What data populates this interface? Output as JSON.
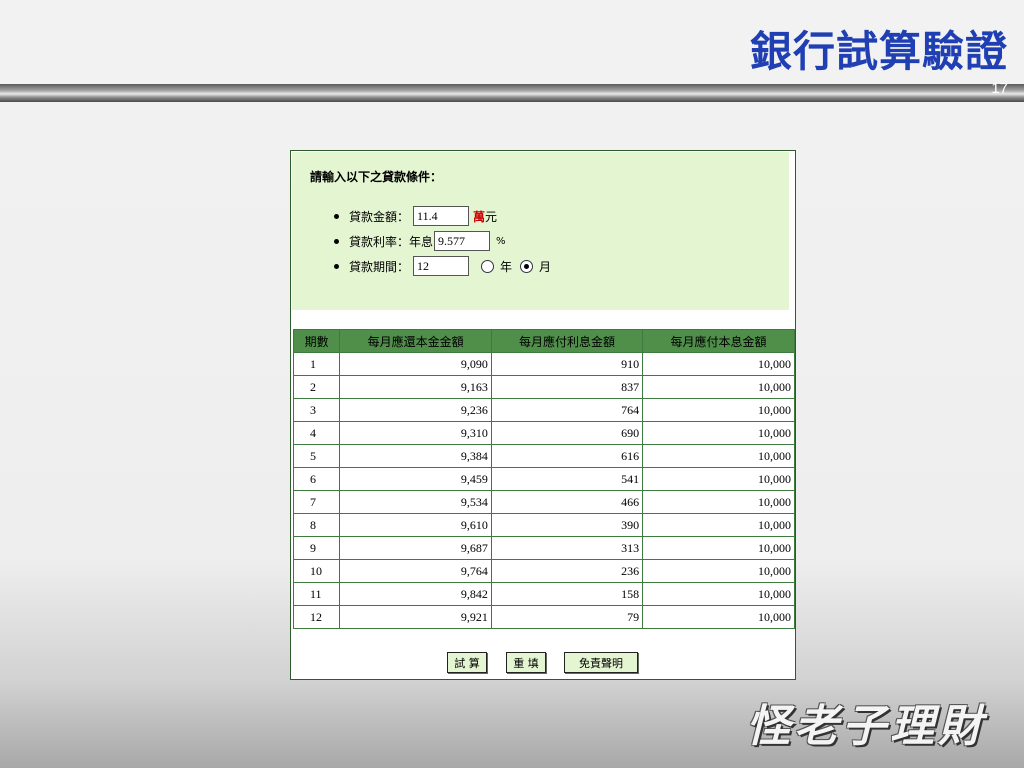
{
  "slide": {
    "title": "銀行試算驗證",
    "page_number": "17",
    "logo_text": "怪老子理財"
  },
  "form": {
    "title": "請輸入以下之貸款條件：",
    "amount_label": "貸款金額：",
    "amount_value": "11.4",
    "amount_unit_red": "萬",
    "amount_unit": "元",
    "rate_label": "貸款利率：年息",
    "rate_value": "9.577",
    "rate_unit": "%",
    "period_label": "貸款期間：",
    "period_value": "12",
    "period_options": [
      {
        "label": "年",
        "selected": false
      },
      {
        "label": "月",
        "selected": true
      }
    ]
  },
  "table": {
    "headers": [
      "期數",
      "每月應還本金金額",
      "每月應付利息金額",
      "每月應付本息金額"
    ],
    "rows": [
      [
        "1",
        "9,090",
        "910",
        "10,000"
      ],
      [
        "2",
        "9,163",
        "837",
        "10,000"
      ],
      [
        "3",
        "9,236",
        "764",
        "10,000"
      ],
      [
        "4",
        "9,310",
        "690",
        "10,000"
      ],
      [
        "5",
        "9,384",
        "616",
        "10,000"
      ],
      [
        "6",
        "9,459",
        "541",
        "10,000"
      ],
      [
        "7",
        "9,534",
        "466",
        "10,000"
      ],
      [
        "8",
        "9,610",
        "390",
        "10,000"
      ],
      [
        "9",
        "9,687",
        "313",
        "10,000"
      ],
      [
        "10",
        "9,764",
        "236",
        "10,000"
      ],
      [
        "11",
        "9,842",
        "158",
        "10,000"
      ],
      [
        "12",
        "9,921",
        "79",
        "10,000"
      ]
    ]
  },
  "buttons": {
    "calculate": "試 算",
    "reset": "重 填",
    "disclaimer": "免責聲明"
  }
}
